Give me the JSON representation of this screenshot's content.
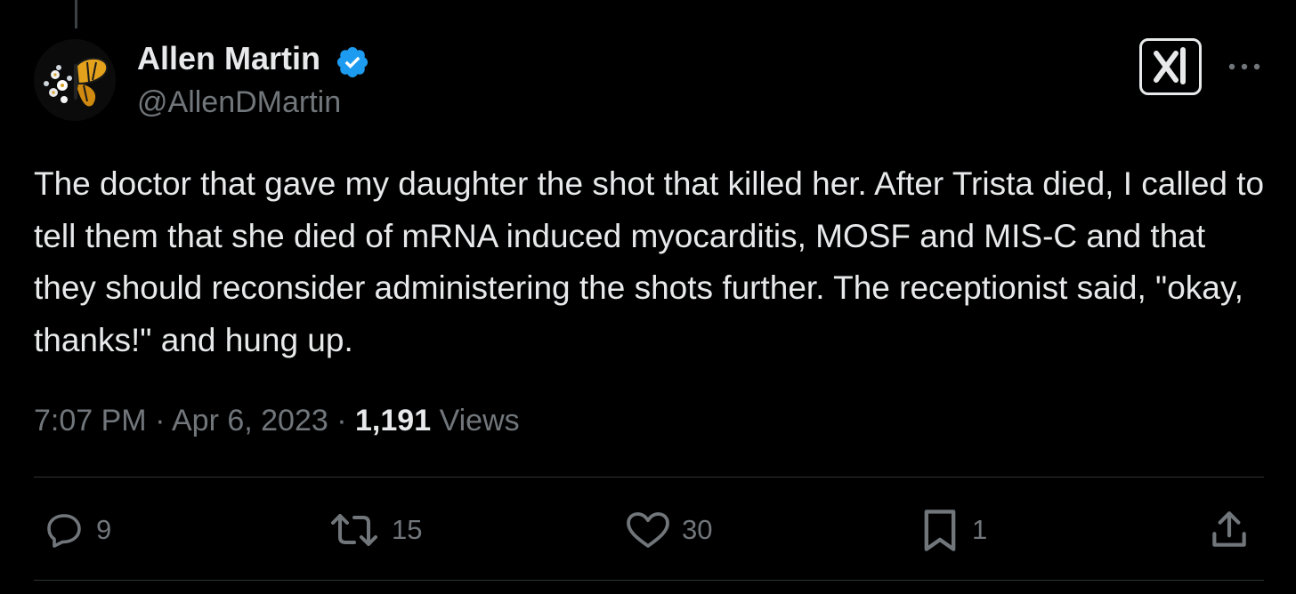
{
  "author": {
    "display_name": "Allen Martin",
    "handle": "@AllenDMartin",
    "verified": true
  },
  "tweet": {
    "text": "The doctor that gave my daughter the shot that killed her. After Trista died, I called to tell them that she died of mRNA induced myocarditis, MOSF and MIS-C and that they should reconsider administering the shots further. The receptionist said, \"okay, thanks!\" and hung up.",
    "time": "7:07 PM",
    "date": "Apr 6, 2023",
    "separator": "·",
    "views_count": "1,191",
    "views_label": "Views"
  },
  "actions": {
    "replies": "9",
    "reposts": "15",
    "likes": "30",
    "bookmarks": "1"
  },
  "icons": {
    "avatar": "butterfly-avatar",
    "verified": "verified-badge-icon",
    "grok": "grok-icon",
    "more": "more-icon",
    "reply": "reply-icon",
    "repost": "repost-icon",
    "like": "heart-icon",
    "bookmark": "bookmark-icon",
    "share": "share-icon"
  },
  "colors": {
    "background": "#000000",
    "text": "#e7e9ea",
    "secondary": "#71767b",
    "verified": "#1d9bf0",
    "divider": "#2f3336",
    "butterfly": "#e3a11c"
  }
}
